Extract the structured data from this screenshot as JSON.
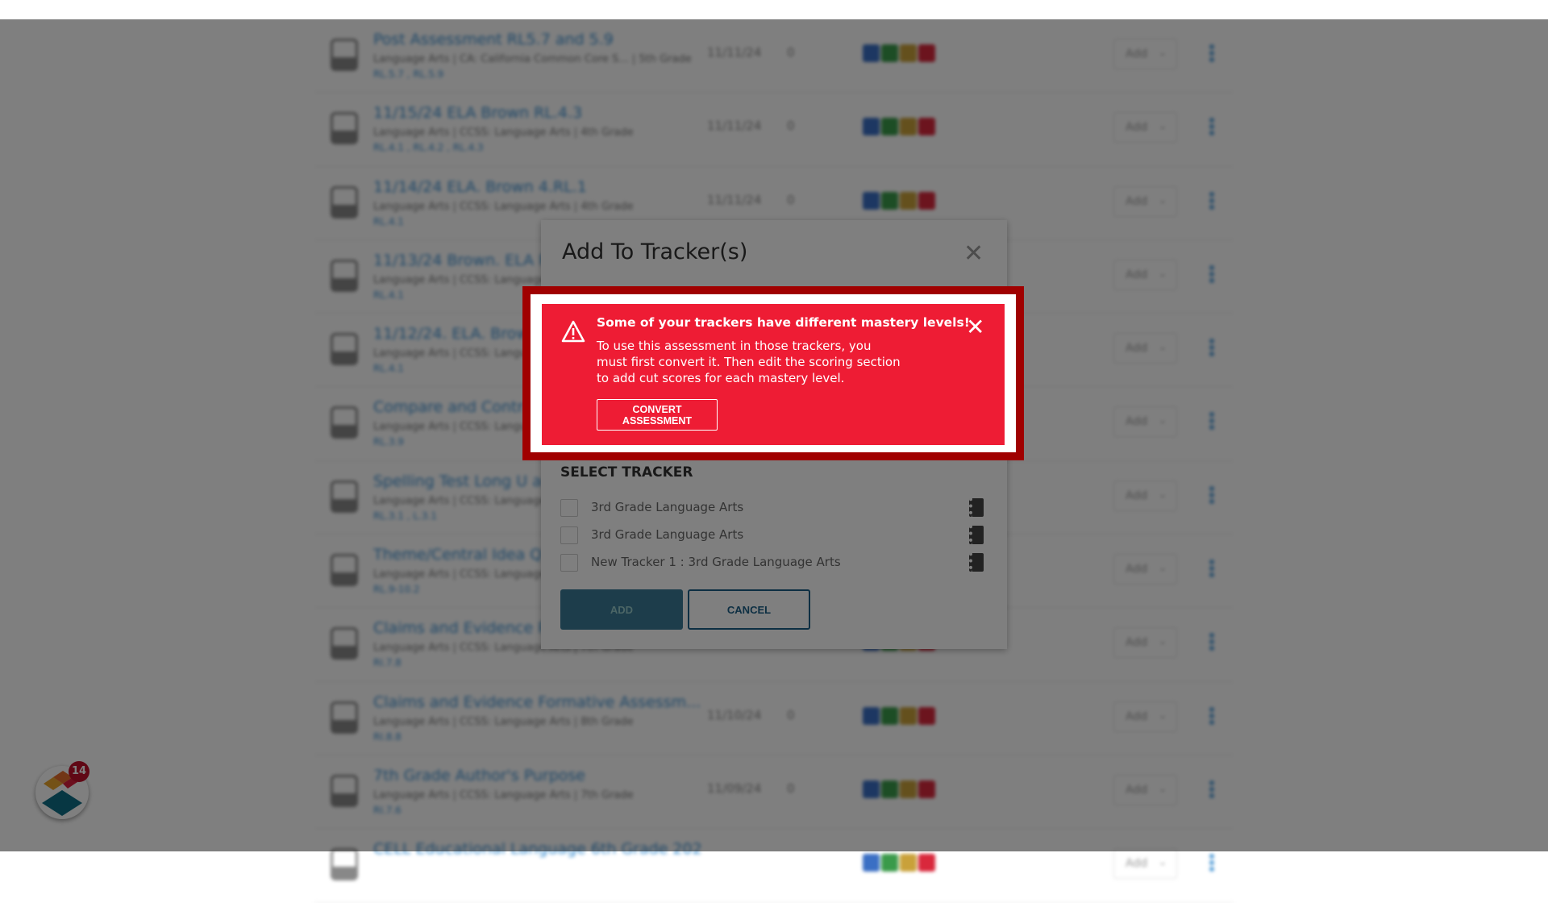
{
  "rows": [
    {
      "title": "Post Assessment RL5.7 and 5.9",
      "meta": "Language Arts  |  CA: California Common Core S...  |  5th Grade",
      "standards": "RL.5.7 , RL.5.9",
      "date": "11/11/24",
      "count": "0"
    },
    {
      "title": "11/15/24 ELA Brown RL.4.3",
      "meta": "Language Arts  |  CCSS: Language Arts  |  4th Grade",
      "standards": "RL.4.1 , RL.4.2 , RL.4.3",
      "date": "11/11/24",
      "count": "0"
    },
    {
      "title": "11/14/24 ELA. Brown 4.RL.1",
      "meta": "Language Arts  |  CCSS: Language Arts  |  4th Grade",
      "standards": "RL.4.1",
      "date": "11/11/24",
      "count": "0"
    },
    {
      "title": "11/13/24 Brown. ELA R",
      "meta": "Language Arts  |  CCSS: Language",
      "standards": "RL.4.1",
      "date": "",
      "count": ""
    },
    {
      "title": "11/12/24. ELA. Brown",
      "meta": "Language Arts  |  CCSS: Language",
      "standards": "RL.4.1",
      "date": "",
      "count": ""
    },
    {
      "title": "Compare and Contrast",
      "meta": "Language Arts  |  CCSS: Language",
      "standards": "RL.3.9",
      "date": "",
      "count": ""
    },
    {
      "title": "Spelling Test Long U a",
      "meta": "Language Arts  |  CCSS: Language",
      "standards": "RL.3.1 , L.3.1",
      "date": "",
      "count": ""
    },
    {
      "title": "Theme/Central Idea Q",
      "meta": "Language Arts  |  CCSS: Language",
      "standards": "RL.9-10.2",
      "date": "",
      "count": ""
    },
    {
      "title": "Claims and Evidence P",
      "meta": "Language Arts  |  CCSS: Language Arts  |  7th Grade",
      "standards": "RI.7.8",
      "date": "",
      "count": ""
    },
    {
      "title": "Claims and Evidence Formative Assessm...",
      "meta": "Language Arts  |  CCSS: Language Arts  |  8th Grade",
      "standards": "RI.8.8",
      "date": "11/10/24",
      "count": "0"
    },
    {
      "title": "7th Grade Author's Purpose",
      "meta": "Language Arts  |  CCSS: Language Arts  |  7th Grade",
      "standards": "RI.7.6",
      "date": "11/09/24",
      "count": "0"
    },
    {
      "title": "CELL Educational Language 6th Grade 202",
      "meta": "",
      "standards": "",
      "date": "",
      "count": ""
    }
  ],
  "row_add_label": "Add",
  "badge_colors": [
    "#3a6fc4",
    "#3a9a4a",
    "#c9a13a",
    "#d9283c"
  ],
  "dialog": {
    "title": "Add To Tracker(s)",
    "alert": {
      "heading": "Some of your trackers have different mastery levels!",
      "body": "To use this assessment in those trackers, you must first convert it. Then edit the scoring section to add cut scores for each mastery level.",
      "convert_label": "CONVERT ASSESSMENT",
      "color": "#ee1c34"
    },
    "select_title": "SELECT TRACKER",
    "trackers": [
      {
        "label": "3rd Grade Language Arts",
        "checked": false
      },
      {
        "label": "3rd Grade Language Arts",
        "checked": false
      },
      {
        "label": "New Tracker 1 : 3rd Grade Language Arts",
        "checked": false
      }
    ],
    "add_label": "ADD",
    "cancel_label": "CANCEL"
  },
  "fab": {
    "badge_count": "14"
  }
}
